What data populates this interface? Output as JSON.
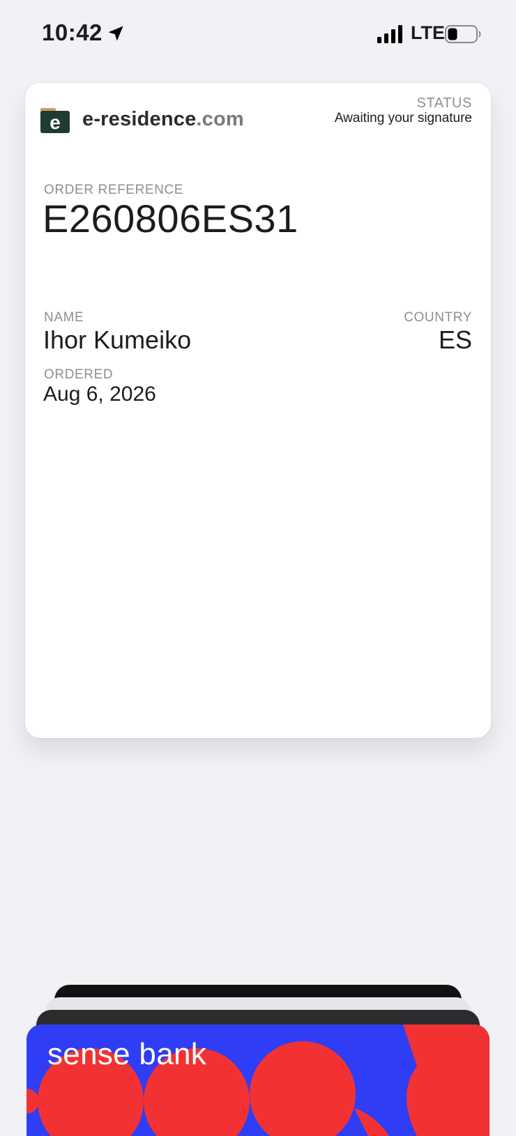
{
  "status_bar": {
    "time": "10:42",
    "network": "LTE",
    "icons": [
      "location-arrow-icon",
      "cellular-signal-icon",
      "battery-icon"
    ]
  },
  "pass": {
    "logo": {
      "name": "e-residence",
      "tld": ".com",
      "icon_letter": "e"
    },
    "status_label": "STATUS",
    "status_value": "Awaiting your signature",
    "order_reference_label": "ORDER REFERENCE",
    "order_reference_value": "E260806ES31",
    "name_label": "NAME",
    "name_value": "Ihor Kumeiko",
    "country_label": "COUNTRY",
    "country_value": "ES",
    "ordered_label": "ORDERED",
    "ordered_value": "Aug 6, 2026"
  },
  "card_stack": {
    "front_card_name": "sense bank",
    "colors": {
      "bank_red": "#f23232",
      "bank_blue": "#2f3df5"
    }
  }
}
